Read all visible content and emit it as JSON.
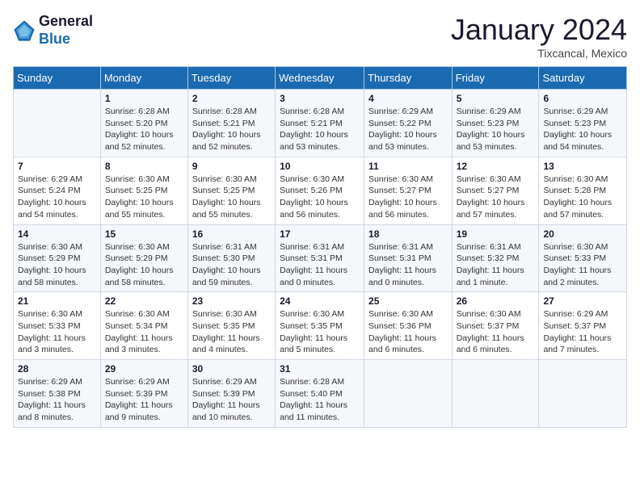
{
  "header": {
    "logo_line1": "General",
    "logo_line2": "Blue",
    "month": "January 2024",
    "location": "Tixcancal, Mexico"
  },
  "weekdays": [
    "Sunday",
    "Monday",
    "Tuesday",
    "Wednesday",
    "Thursday",
    "Friday",
    "Saturday"
  ],
  "weeks": [
    [
      {
        "day": "",
        "sunrise": "",
        "sunset": "",
        "daylight": ""
      },
      {
        "day": "1",
        "sunrise": "Sunrise: 6:28 AM",
        "sunset": "Sunset: 5:20 PM",
        "daylight": "Daylight: 10 hours and 52 minutes."
      },
      {
        "day": "2",
        "sunrise": "Sunrise: 6:28 AM",
        "sunset": "Sunset: 5:21 PM",
        "daylight": "Daylight: 10 hours and 52 minutes."
      },
      {
        "day": "3",
        "sunrise": "Sunrise: 6:28 AM",
        "sunset": "Sunset: 5:21 PM",
        "daylight": "Daylight: 10 hours and 53 minutes."
      },
      {
        "day": "4",
        "sunrise": "Sunrise: 6:29 AM",
        "sunset": "Sunset: 5:22 PM",
        "daylight": "Daylight: 10 hours and 53 minutes."
      },
      {
        "day": "5",
        "sunrise": "Sunrise: 6:29 AM",
        "sunset": "Sunset: 5:23 PM",
        "daylight": "Daylight: 10 hours and 53 minutes."
      },
      {
        "day": "6",
        "sunrise": "Sunrise: 6:29 AM",
        "sunset": "Sunset: 5:23 PM",
        "daylight": "Daylight: 10 hours and 54 minutes."
      }
    ],
    [
      {
        "day": "7",
        "sunrise": "Sunrise: 6:29 AM",
        "sunset": "Sunset: 5:24 PM",
        "daylight": "Daylight: 10 hours and 54 minutes."
      },
      {
        "day": "8",
        "sunrise": "Sunrise: 6:30 AM",
        "sunset": "Sunset: 5:25 PM",
        "daylight": "Daylight: 10 hours and 55 minutes."
      },
      {
        "day": "9",
        "sunrise": "Sunrise: 6:30 AM",
        "sunset": "Sunset: 5:25 PM",
        "daylight": "Daylight: 10 hours and 55 minutes."
      },
      {
        "day": "10",
        "sunrise": "Sunrise: 6:30 AM",
        "sunset": "Sunset: 5:26 PM",
        "daylight": "Daylight: 10 hours and 56 minutes."
      },
      {
        "day": "11",
        "sunrise": "Sunrise: 6:30 AM",
        "sunset": "Sunset: 5:27 PM",
        "daylight": "Daylight: 10 hours and 56 minutes."
      },
      {
        "day": "12",
        "sunrise": "Sunrise: 6:30 AM",
        "sunset": "Sunset: 5:27 PM",
        "daylight": "Daylight: 10 hours and 57 minutes."
      },
      {
        "day": "13",
        "sunrise": "Sunrise: 6:30 AM",
        "sunset": "Sunset: 5:28 PM",
        "daylight": "Daylight: 10 hours and 57 minutes."
      }
    ],
    [
      {
        "day": "14",
        "sunrise": "Sunrise: 6:30 AM",
        "sunset": "Sunset: 5:29 PM",
        "daylight": "Daylight: 10 hours and 58 minutes."
      },
      {
        "day": "15",
        "sunrise": "Sunrise: 6:30 AM",
        "sunset": "Sunset: 5:29 PM",
        "daylight": "Daylight: 10 hours and 58 minutes."
      },
      {
        "day": "16",
        "sunrise": "Sunrise: 6:31 AM",
        "sunset": "Sunset: 5:30 PM",
        "daylight": "Daylight: 10 hours and 59 minutes."
      },
      {
        "day": "17",
        "sunrise": "Sunrise: 6:31 AM",
        "sunset": "Sunset: 5:31 PM",
        "daylight": "Daylight: 11 hours and 0 minutes."
      },
      {
        "day": "18",
        "sunrise": "Sunrise: 6:31 AM",
        "sunset": "Sunset: 5:31 PM",
        "daylight": "Daylight: 11 hours and 0 minutes."
      },
      {
        "day": "19",
        "sunrise": "Sunrise: 6:31 AM",
        "sunset": "Sunset: 5:32 PM",
        "daylight": "Daylight: 11 hours and 1 minute."
      },
      {
        "day": "20",
        "sunrise": "Sunrise: 6:30 AM",
        "sunset": "Sunset: 5:33 PM",
        "daylight": "Daylight: 11 hours and 2 minutes."
      }
    ],
    [
      {
        "day": "21",
        "sunrise": "Sunrise: 6:30 AM",
        "sunset": "Sunset: 5:33 PM",
        "daylight": "Daylight: 11 hours and 3 minutes."
      },
      {
        "day": "22",
        "sunrise": "Sunrise: 6:30 AM",
        "sunset": "Sunset: 5:34 PM",
        "daylight": "Daylight: 11 hours and 3 minutes."
      },
      {
        "day": "23",
        "sunrise": "Sunrise: 6:30 AM",
        "sunset": "Sunset: 5:35 PM",
        "daylight": "Daylight: 11 hours and 4 minutes."
      },
      {
        "day": "24",
        "sunrise": "Sunrise: 6:30 AM",
        "sunset": "Sunset: 5:35 PM",
        "daylight": "Daylight: 11 hours and 5 minutes."
      },
      {
        "day": "25",
        "sunrise": "Sunrise: 6:30 AM",
        "sunset": "Sunset: 5:36 PM",
        "daylight": "Daylight: 11 hours and 6 minutes."
      },
      {
        "day": "26",
        "sunrise": "Sunrise: 6:30 AM",
        "sunset": "Sunset: 5:37 PM",
        "daylight": "Daylight: 11 hours and 6 minutes."
      },
      {
        "day": "27",
        "sunrise": "Sunrise: 6:29 AM",
        "sunset": "Sunset: 5:37 PM",
        "daylight": "Daylight: 11 hours and 7 minutes."
      }
    ],
    [
      {
        "day": "28",
        "sunrise": "Sunrise: 6:29 AM",
        "sunset": "Sunset: 5:38 PM",
        "daylight": "Daylight: 11 hours and 8 minutes."
      },
      {
        "day": "29",
        "sunrise": "Sunrise: 6:29 AM",
        "sunset": "Sunset: 5:39 PM",
        "daylight": "Daylight: 11 hours and 9 minutes."
      },
      {
        "day": "30",
        "sunrise": "Sunrise: 6:29 AM",
        "sunset": "Sunset: 5:39 PM",
        "daylight": "Daylight: 11 hours and 10 minutes."
      },
      {
        "day": "31",
        "sunrise": "Sunrise: 6:28 AM",
        "sunset": "Sunset: 5:40 PM",
        "daylight": "Daylight: 11 hours and 11 minutes."
      },
      {
        "day": "",
        "sunrise": "",
        "sunset": "",
        "daylight": ""
      },
      {
        "day": "",
        "sunrise": "",
        "sunset": "",
        "daylight": ""
      },
      {
        "day": "",
        "sunrise": "",
        "sunset": "",
        "daylight": ""
      }
    ]
  ]
}
